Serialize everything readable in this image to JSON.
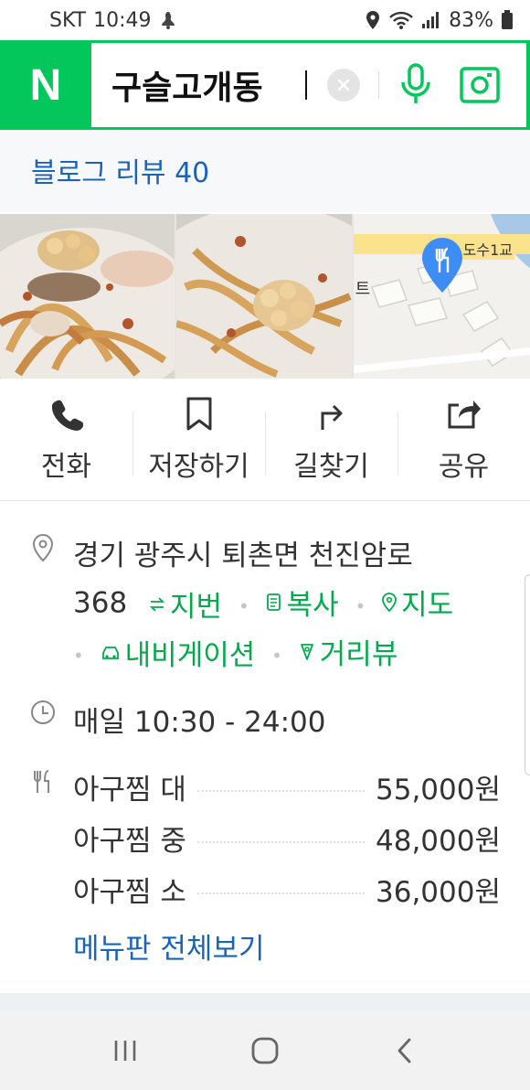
{
  "status_bar": {
    "carrier": "SKT",
    "time": "10:49",
    "battery": "83%",
    "icons": [
      "notification-icon",
      "location-icon",
      "wifi-icon",
      "signal-icon",
      "battery-icon"
    ]
  },
  "search": {
    "logo": "N",
    "query": "구슬고개동",
    "icons": [
      "clear-icon",
      "microphone-icon",
      "lens-icon"
    ]
  },
  "blog_review": {
    "label": "블로그 리뷰 40"
  },
  "map_thumb": {
    "labels": [
      "도수1교",
      "트"
    ]
  },
  "actions": [
    {
      "label": "전화",
      "icon": "phone-icon"
    },
    {
      "label": "저장하기",
      "icon": "bookmark-icon"
    },
    {
      "label": "길찾기",
      "icon": "directions-icon"
    },
    {
      "label": "공유",
      "icon": "share-icon"
    }
  ],
  "address": {
    "line1": "경기 광주시 퇴촌면 천진암로",
    "line2_prefix": "368",
    "links": [
      "지번",
      "복사",
      "지도",
      "내비게이션",
      "거리뷰"
    ]
  },
  "hours": {
    "text": "매일 10:30 - 24:00"
  },
  "menu": {
    "items": [
      {
        "name": "아구찜 대",
        "price": "55,000원"
      },
      {
        "name": "아구찜 중",
        "price": "48,000원"
      },
      {
        "name": "아구찜 소",
        "price": "36,000원"
      }
    ],
    "view_all": "메뉴판 전체보기"
  },
  "colors": {
    "naver_green": "#03c75a",
    "link_green": "#03a94d",
    "link_blue": "#1a64b8",
    "map_pin": "#3d8df5"
  }
}
